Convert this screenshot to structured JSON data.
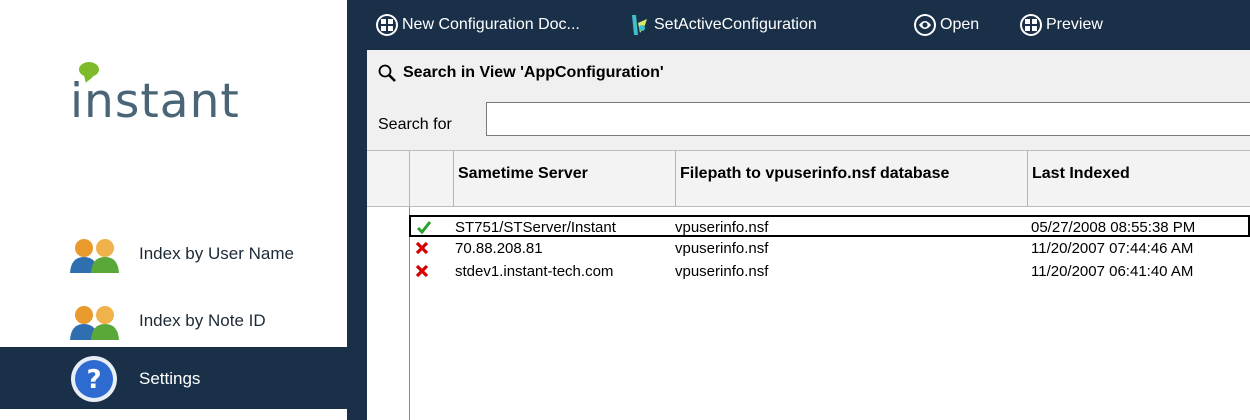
{
  "brand": {
    "logo_text": "instant",
    "logo_dot_color": "#7fba2a"
  },
  "sidebar": {
    "items": [
      {
        "label": "Index by User Name",
        "icon": "users-icon"
      },
      {
        "label": "Index by Note ID",
        "icon": "users-icon"
      },
      {
        "label": "Settings",
        "icon": "help-icon",
        "selected": true
      }
    ]
  },
  "toolbar": {
    "buttons": [
      {
        "label": "New Configuration Doc...",
        "icon": "new-document-icon"
      },
      {
        "label": "SetActiveConfiguration",
        "icon": "set-active-icon"
      },
      {
        "label": "Open",
        "icon": "open-icon"
      },
      {
        "label": "Preview",
        "icon": "preview-icon"
      }
    ]
  },
  "search": {
    "title": "Search in View 'AppConfiguration'",
    "label": "Search for",
    "value": ""
  },
  "table": {
    "columns": [
      "Sametime Server",
      "Filepath to vpuserinfo.nsf database",
      "Last Indexed"
    ],
    "rows": [
      {
        "status": "active",
        "server": "ST751/STServer/Instant",
        "filepath": "vpuserinfo.nsf",
        "last_indexed": "05/27/2008 08:55:38 PM",
        "selected": true
      },
      {
        "status": "inactive",
        "server": "70.88.208.81",
        "filepath": "vpuserinfo.nsf",
        "last_indexed": "11/20/2007 07:44:46 AM",
        "selected": false
      },
      {
        "status": "inactive",
        "server": "stdev1.instant-tech.com",
        "filepath": "vpuserinfo.nsf",
        "last_indexed": "11/20/2007 06:41:40 AM",
        "selected": false
      }
    ]
  },
  "colors": {
    "navy": "#1a3049",
    "check": "#2aa02a",
    "cross": "#d40000"
  }
}
